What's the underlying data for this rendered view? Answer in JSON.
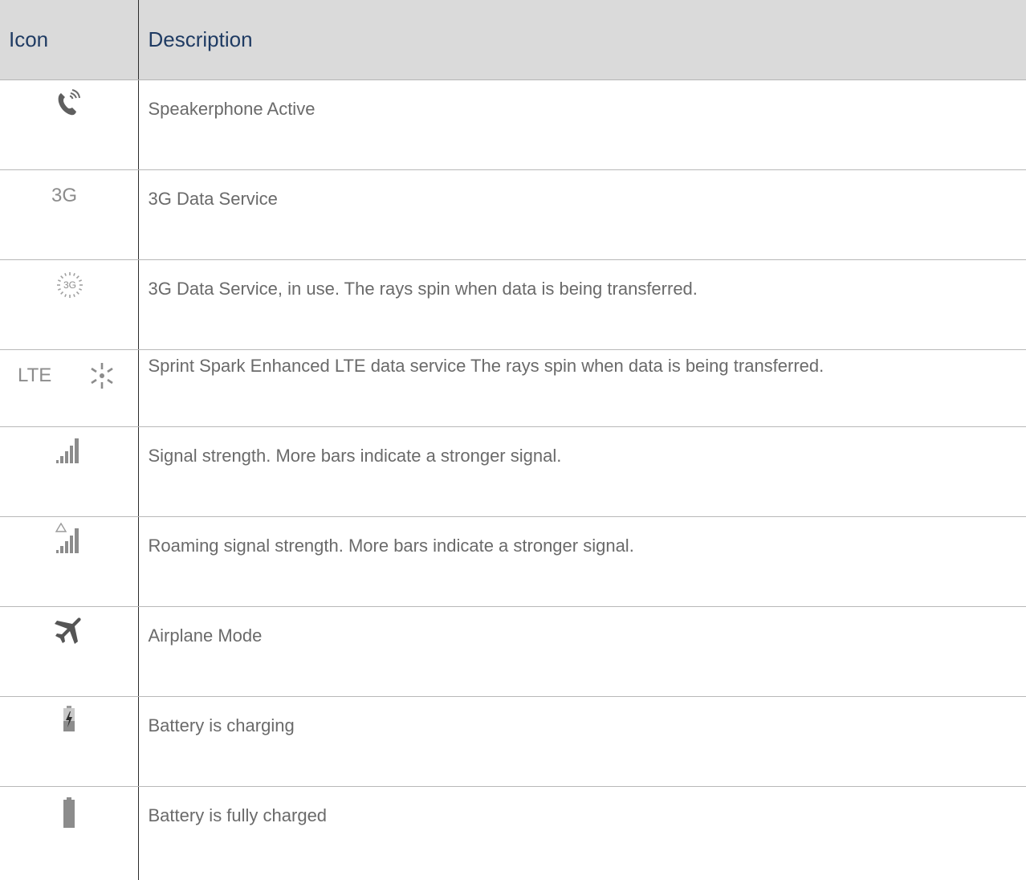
{
  "table": {
    "headers": {
      "icon": "Icon",
      "description": "Description"
    },
    "rows": [
      {
        "icon": "speakerphone-icon",
        "description": "Speakerphone Active"
      },
      {
        "icon": "3g-icon",
        "icon_text": "3G",
        "description": "3G Data Service"
      },
      {
        "icon": "3g-in-use-icon",
        "icon_text": "3G",
        "description": "3G Data Service, in use. The rays spin when data is being transferred."
      },
      {
        "icon": "lte-spark-icon",
        "icon_text": "LTE",
        "description": "Sprint Spark Enhanced LTE data service The rays spin when data is being transferred."
      },
      {
        "icon": "signal-strength-icon",
        "description": "Signal strength. More bars indicate a stronger signal."
      },
      {
        "icon": "roaming-signal-icon",
        "description": "Roaming signal strength. More bars indicate a stronger signal."
      },
      {
        "icon": "airplane-icon",
        "description": "Airplane Mode"
      },
      {
        "icon": "battery-charging-icon",
        "description": "Battery is charging"
      },
      {
        "icon": "battery-full-icon",
        "description": "Battery is fully charged"
      }
    ]
  },
  "colors": {
    "header_bg": "#dadada",
    "header_text": "#1f3b63",
    "body_text": "#6a6a6a",
    "icon_gray": "#8c8c8c"
  }
}
